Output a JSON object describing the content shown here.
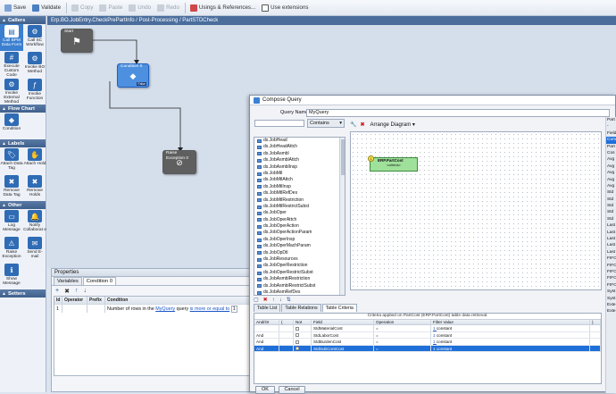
{
  "toolbar": {
    "save": "Save",
    "validate": "Validate",
    "copy": "Copy",
    "paste": "Paste",
    "undo": "Undo",
    "redo": "Redo",
    "usings": "Usings & References...",
    "use_extensions": "Use extensions"
  },
  "breadcrumb": "Erp.BO.JobEntry.CheckPrePartInfo / Post-Processing / PartSTDCheck",
  "left": {
    "callers_title": "Callers",
    "callers": [
      {
        "label": "Call BPM Data Form",
        "icon": "form-icon",
        "selected": true
      },
      {
        "label": "Call SC Workflow",
        "icon": "workflow-icon"
      },
      {
        "label": "Execute Custom Code",
        "icon": "code-icon"
      },
      {
        "label": "Invoke BO Method",
        "icon": "method-icon"
      },
      {
        "label": "Invoke External Method",
        "icon": "external-icon"
      },
      {
        "label": "Invoke Function",
        "icon": "function-icon"
      }
    ],
    "flow_title": "Flow Chart",
    "flow": [
      {
        "label": "Condition",
        "icon": "condition-icon"
      }
    ],
    "labels_title": "Labels",
    "labels": [
      {
        "label": "Attach Data Tag",
        "icon": "tag-icon"
      },
      {
        "label": "Attach Hold",
        "icon": "hold-icon"
      },
      {
        "label": "Remove Data Tag",
        "icon": "remove-tag-icon"
      },
      {
        "label": "Remove Holds",
        "icon": "remove-hold-icon"
      }
    ],
    "other_title": "Other",
    "other": [
      {
        "label": "Log Message",
        "icon": "log-icon"
      },
      {
        "label": "Notify Collaborat e",
        "icon": "notify-icon"
      },
      {
        "label": "Raise Exception",
        "icon": "exception-icon"
      },
      {
        "label": "Send E-mail",
        "icon": "email-icon"
      },
      {
        "label": "Show Message",
        "icon": "message-icon"
      }
    ],
    "setters_title": "Setters"
  },
  "nodes": {
    "start": "Start",
    "condition": "Condition 0",
    "condition_false": "False",
    "raise": "Raise Exception 0"
  },
  "properties": {
    "title": "Properties",
    "tabs": [
      "Variables",
      "Condition 0"
    ],
    "columns": [
      "Id",
      "Operator",
      "Prefix",
      "Condition"
    ],
    "row": {
      "id": "1",
      "text_pre": "Number of rows in the",
      "link1": "MyQuery",
      "text_mid": "query",
      "link2": "is more or equal to",
      "value": "1"
    }
  },
  "dialog": {
    "title": "Compose Query",
    "query_name_label": "Query Name:",
    "query_name": "MyQuery",
    "contains": "Contains",
    "arrange": "Arrange Diagram",
    "tables": [
      "ds.JobHead",
      "ds.JobHeadAttch",
      "ds.JobAsmbl",
      "ds.JobAsmblAttch",
      "ds.JobAsmblInsp",
      "ds.JobMtl",
      "ds.JobMtlAttch",
      "ds.JobMtlInsp",
      "ds.JobMtlRefDes",
      "ds.JobMtlRestriction",
      "ds.JobMtlRestrictSubst",
      "ds.JobOper",
      "ds.JobOperAttch",
      "ds.JobOperAction",
      "ds.JobOperActionParam",
      "ds.JobOperInsp",
      "ds.JobOperMachParam",
      "ds.JobOpDtl",
      "ds.JobResources",
      "ds.JobOperRestriction",
      "ds.JobOperRestrictSubst",
      "ds.JobAsmblRestriction",
      "ds.JobAsmblRestrictSubst",
      "ds.JobAsmRefDes",
      "ds.JobAudit",
      "ds.JobPart"
    ],
    "entity_title": "ERP.PartCost",
    "entity_sub": "<criteria>",
    "bottom_tabs": [
      "Table List",
      "Table Relations",
      "Table Criteria"
    ],
    "criteria_note": "Criteria applied on PartCost (ERP.PartCost) table data retrieval.",
    "criteria_columns": [
      "And/Or",
      "(",
      "Not",
      "Field",
      "Operation",
      "Filter Value",
      ")"
    ],
    "criteria_rows": [
      {
        "andor": "",
        "field": "StdMaterialCost",
        "op": "=",
        "value": "constant"
      },
      {
        "andor": "And",
        "field": "StdLaborCost",
        "op": "=",
        "value": "constant"
      },
      {
        "andor": "And",
        "field": "StdBurdenCost",
        "op": "=",
        "value": "constant"
      },
      {
        "andor": "And",
        "field": "StdSubContCost",
        "op": "=",
        "value": "constant"
      }
    ],
    "right_labels": [
      "Part",
      "-",
      "Field",
      "Com",
      "Part",
      "Cos",
      "Avg",
      "Avg",
      "Avg",
      "Avg",
      "Avg",
      "Std",
      "Std",
      "Std",
      "Std",
      "Std",
      "Last",
      "Last",
      "Last",
      "Last",
      "Last",
      "FIFO",
      "FIFO",
      "FIFO",
      "FIFO",
      "FIFO",
      "Syst",
      "Syst",
      "Exte",
      "Exte"
    ],
    "ok": "OK",
    "cancel": "Cancel"
  }
}
